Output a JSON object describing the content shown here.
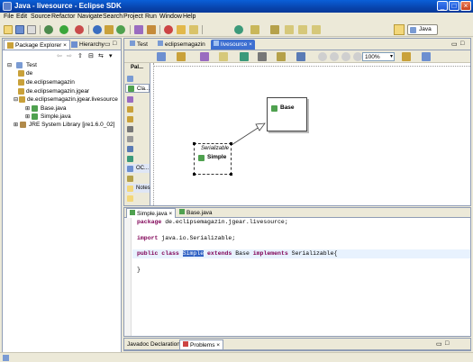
{
  "window": {
    "title": "Java - livesource - Eclipse SDK"
  },
  "menu": [
    "File",
    "Edit",
    "Source",
    "Refactor",
    "Navigate",
    "Search",
    "Project",
    "Run",
    "Window",
    "Help"
  ],
  "perspective": {
    "label": "Java"
  },
  "left_panel": {
    "tabs": [
      {
        "label": "Package Explorer"
      },
      {
        "label": "Hierarchy"
      }
    ],
    "tree": [
      {
        "label": "Test",
        "depth": 0
      },
      {
        "label": "de",
        "depth": 1
      },
      {
        "label": "de.eclipsemagazin",
        "depth": 1
      },
      {
        "label": "de.eclipsemagazin.jgear",
        "depth": 1
      },
      {
        "label": "de.eclipsemagazin.jgear.livesource",
        "depth": 1
      },
      {
        "label": "Base.java",
        "depth": 2
      },
      {
        "label": "Simple.java",
        "depth": 2
      },
      {
        "label": "JRE System Library [jre1.6.0_02]",
        "depth": 1
      }
    ]
  },
  "editor_tabs": [
    {
      "label": "Test"
    },
    {
      "label": "eclipsemagazin"
    },
    {
      "label": "livesource"
    }
  ],
  "diagram": {
    "zoom": "100%",
    "palette": {
      "title": "Pal...",
      "items": [
        "",
        "Cla...",
        "",
        "",
        "",
        "",
        "",
        "",
        "",
        "",
        "OC...",
        "",
        "Notes",
        ""
      ]
    },
    "nodes": [
      {
        "id": "base",
        "name": "Base",
        "stereotype": ""
      },
      {
        "id": "simple",
        "name": "Simple",
        "stereotype": "Serializable"
      }
    ]
  },
  "source_tabs": [
    {
      "label": "Simple.java"
    },
    {
      "label": "Base.java"
    }
  ],
  "code": {
    "package_kw": "package",
    "package_name": " de.eclipsemagazin.jgear.livesource;",
    "import_kw": "import",
    "import_name": " java.io.Serializable;",
    "line3_public": "public",
    "line3_class": " class ",
    "line3_name": "Simple",
    "line3_extends": " extends",
    "line3_base": " Base ",
    "line3_impl": "implements",
    "line3_rest": " Serializable{",
    "line4": "}"
  },
  "bottom_tabs": [
    {
      "label": "Javadoc"
    },
    {
      "label": "Declaration"
    },
    {
      "label": "Problems"
    }
  ]
}
